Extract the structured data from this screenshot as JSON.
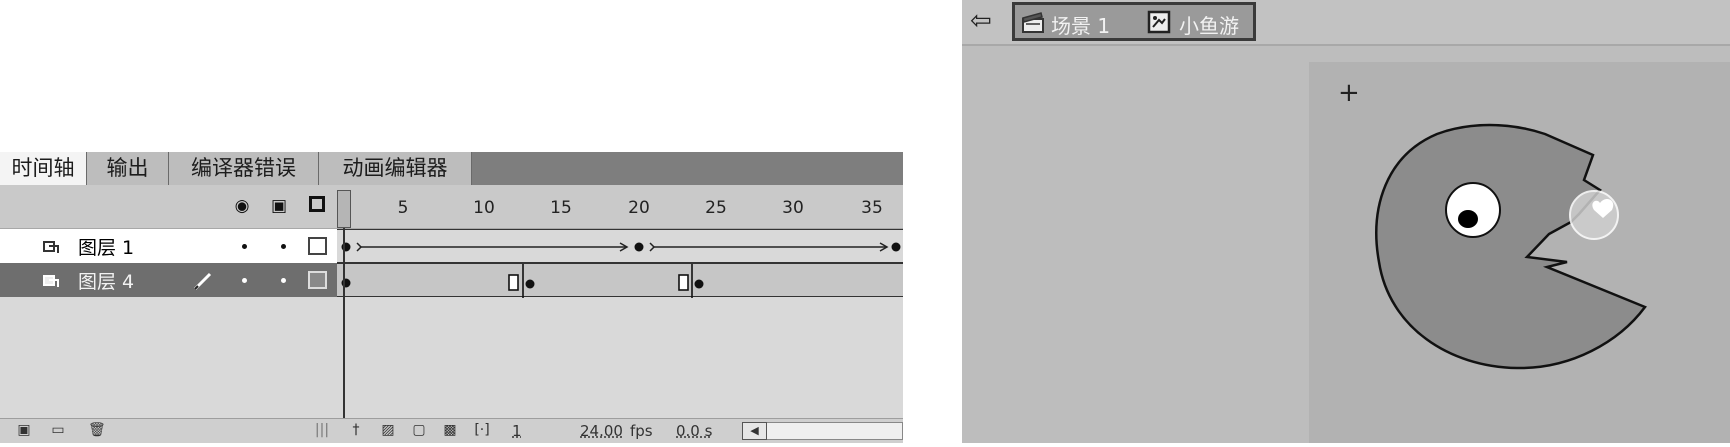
{
  "timeline": {
    "tabs": [
      "时间轴",
      "输出",
      "编译器错误",
      "动画编辑器"
    ],
    "ruler": [
      "5",
      "10",
      "15",
      "20",
      "25",
      "30",
      "35"
    ],
    "layers": [
      {
        "name": "图层 1",
        "selected": false
      },
      {
        "name": "图层 4",
        "selected": true
      }
    ],
    "footer": {
      "current_frame": "1",
      "fps": "24.00",
      "fps_unit": "fps",
      "time": "0.0 s"
    }
  },
  "stage": {
    "breadcrumb": [
      {
        "icon": "scene-clapper-icon",
        "label": "场景 1"
      },
      {
        "icon": "movieclip-symbol-icon",
        "label": "小鱼游"
      }
    ]
  },
  "colors": {
    "panel_bg": "#d9d9d9",
    "selected_layer": "#6e6e6e",
    "stage_bg": "#bdbdbd",
    "fish_body": "#8c8c8c"
  }
}
